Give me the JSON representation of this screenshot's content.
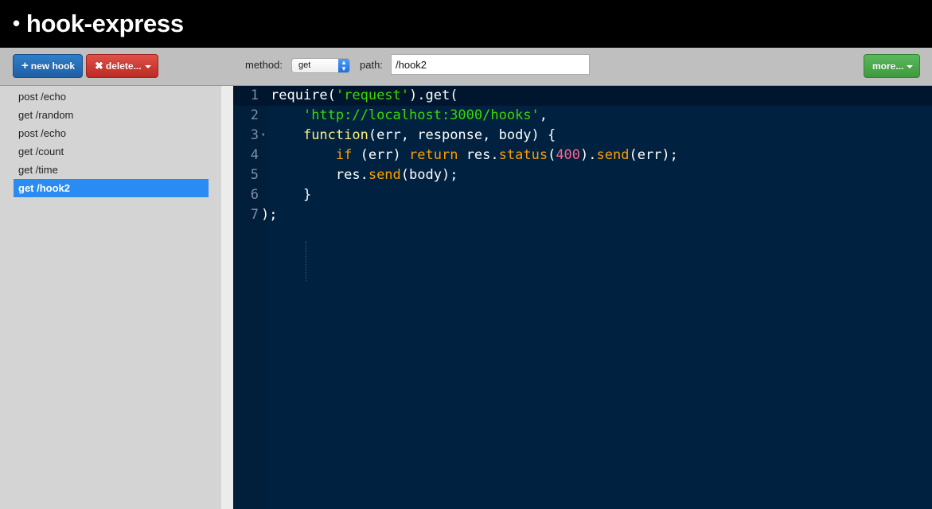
{
  "app": {
    "title": "hook-express",
    "bullet": "•"
  },
  "toolbar": {
    "new_hook_label": "new hook",
    "delete_label": "delete...",
    "method_label": "method:",
    "method_value": "get",
    "path_label": "path:",
    "path_value": "/hook2",
    "more_label": "more..."
  },
  "sidebar": {
    "items": [
      {
        "label": "post /echo"
      },
      {
        "label": "get /random"
      },
      {
        "label": "post /echo"
      },
      {
        "label": "get /count"
      },
      {
        "label": "get /time"
      },
      {
        "label": "get /hook2",
        "active": true
      }
    ]
  },
  "editor": {
    "line_numbers": [
      "1",
      "2",
      "3",
      "4",
      "5",
      "6",
      "7"
    ],
    "lines": {
      "l1": {
        "a": "require(",
        "b": "'request'",
        "c": ").get("
      },
      "l2": {
        "a": "    ",
        "b": "'http://localhost:3000/hooks'",
        "c": ","
      },
      "l3": {
        "a": "    ",
        "b": "function",
        "c": "(err, response, body) {"
      },
      "l4": {
        "a": "        ",
        "b": "if",
        "c": " (err) ",
        "d": "return",
        "e": " res.",
        "f": "status",
        "g": "(",
        "h": "400",
        "i": ").",
        "j": "send",
        "k": "(err);"
      },
      "l5": {
        "a": "        res.",
        "b": "send",
        "c": "(body);"
      },
      "l6": {
        "a": "    }"
      },
      "l7": {
        "a": ");"
      }
    }
  },
  "colors": {
    "editor_bg": "#002240",
    "string": "#3ad900",
    "function": "#ffee80",
    "keyword": "#ff9d00",
    "number": "#ff628c",
    "active_item": "#2a8bf2"
  },
  "icons": {
    "new_hook": "plus-icon",
    "delete": "x-icon",
    "dropdown": "chevron-down-icon",
    "select": "select-arrows-icon",
    "fold": "fold-arrow-icon"
  }
}
